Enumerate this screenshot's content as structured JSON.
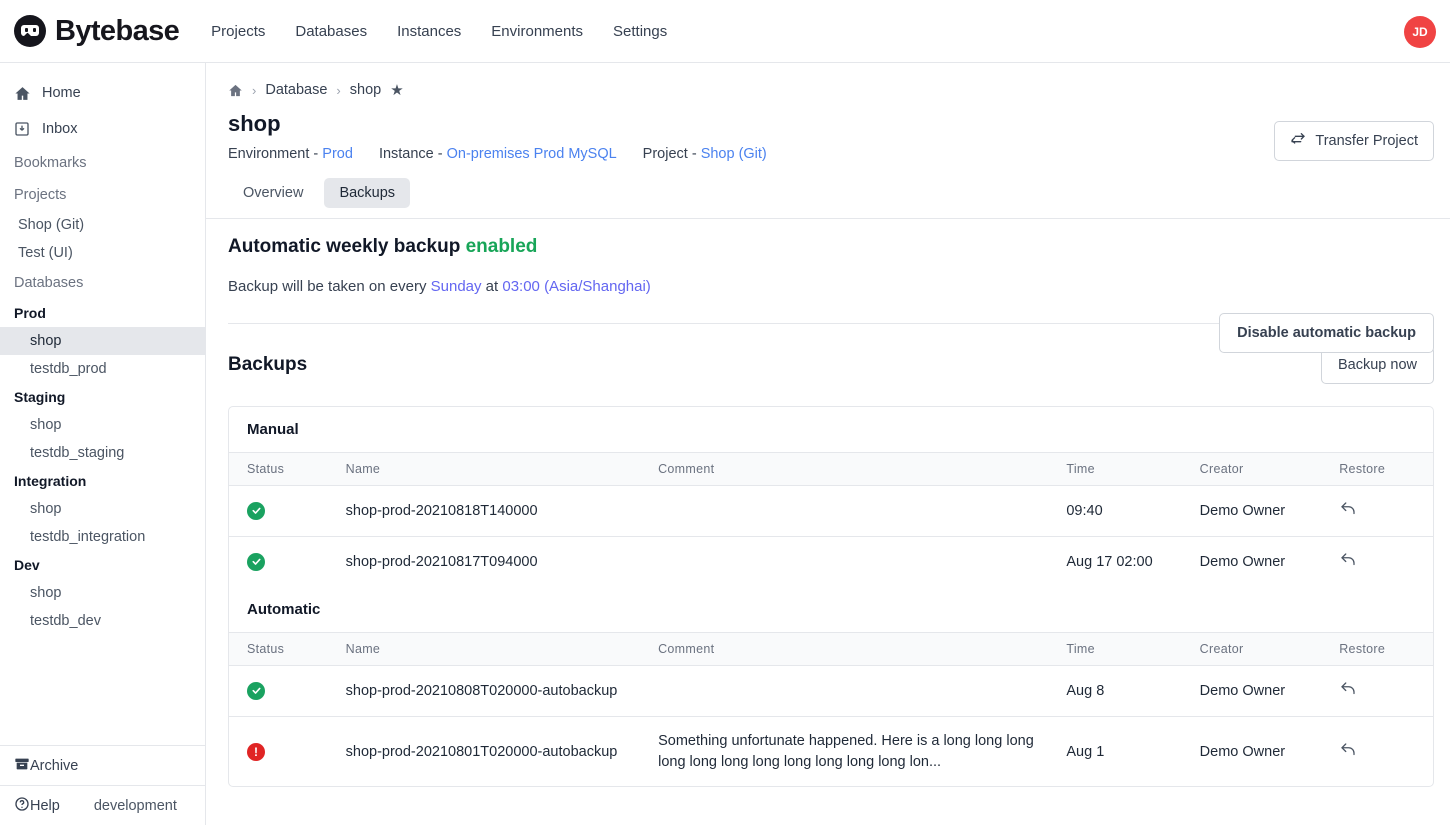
{
  "app": {
    "brand": "Bytebase",
    "nav": [
      {
        "label": "Projects"
      },
      {
        "label": "Databases"
      },
      {
        "label": "Instances"
      },
      {
        "label": "Environments"
      },
      {
        "label": "Settings"
      }
    ],
    "avatar_initials": "JD",
    "avatar_color": "#f04343"
  },
  "sidebar": {
    "home": "Home",
    "inbox": "Inbox",
    "bookmarks": "Bookmarks",
    "projects_label": "Projects",
    "projects": [
      {
        "label": "Shop (Git)"
      },
      {
        "label": "Test (UI)"
      }
    ],
    "databases_label": "Databases",
    "environments": [
      {
        "name": "Prod",
        "databases": [
          {
            "label": "shop",
            "active": true
          },
          {
            "label": "testdb_prod",
            "active": false
          }
        ]
      },
      {
        "name": "Staging",
        "databases": [
          {
            "label": "shop",
            "active": false
          },
          {
            "label": "testdb_staging",
            "active": false
          }
        ]
      },
      {
        "name": "Integration",
        "databases": [
          {
            "label": "shop",
            "active": false
          },
          {
            "label": "testdb_integration",
            "active": false
          }
        ]
      },
      {
        "name": "Dev",
        "databases": [
          {
            "label": "shop",
            "active": false
          },
          {
            "label": "testdb_dev",
            "active": false
          }
        ]
      }
    ],
    "archive": "Archive",
    "help": "Help",
    "version": "development"
  },
  "breadcrumb": {
    "database": "Database",
    "current": "shop"
  },
  "header": {
    "title": "shop",
    "environment_label": "Environment - ",
    "environment_value": "Prod",
    "instance_label": "Instance - ",
    "instance_value": "On-premises Prod MySQL",
    "project_label": "Project - ",
    "project_value": "Shop (Git)",
    "transfer_button": "Transfer Project"
  },
  "tabs": [
    {
      "label": "Overview",
      "active": false
    },
    {
      "label": "Backups",
      "active": true
    }
  ],
  "auto_backup": {
    "title_prefix": "Automatic weekly backup ",
    "status": "enabled",
    "status_color": "#18a558",
    "schedule_prefix": "Backup will be taken on every ",
    "schedule_day": "Sunday",
    "schedule_mid": " at ",
    "schedule_time": "03:00 (Asia/Shanghai)",
    "disable_button": "Disable automatic backup"
  },
  "backups": {
    "title": "Backups",
    "backup_now_button": "Backup now",
    "columns": [
      "Status",
      "Name",
      "Comment",
      "Time",
      "Creator",
      "Restore"
    ],
    "groups": [
      {
        "title": "Manual",
        "rows": [
          {
            "status": "success",
            "name": "shop-prod-20210818T140000",
            "comment": "",
            "time": "09:40",
            "creator": "Demo Owner",
            "restore": "restore-icon"
          },
          {
            "status": "success",
            "name": "shop-prod-20210817T094000",
            "comment": "",
            "time": "Aug 17 02:00",
            "creator": "Demo Owner",
            "restore": "restore-icon"
          }
        ]
      },
      {
        "title": "Automatic",
        "rows": [
          {
            "status": "success",
            "name": "shop-prod-20210808T020000-autobackup",
            "comment": "",
            "time": "Aug 8",
            "creator": "Demo Owner",
            "restore": "restore-icon"
          },
          {
            "status": "error",
            "name": "shop-prod-20210801T020000-autobackup",
            "comment": "Something unfortunate happened. Here is a long long long long long long long long long long long lon...",
            "time": "Aug 1",
            "creator": "Demo Owner",
            "restore": "restore-icon"
          }
        ]
      }
    ]
  }
}
